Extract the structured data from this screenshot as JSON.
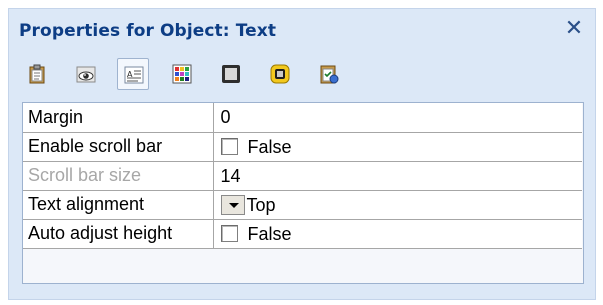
{
  "panel": {
    "title": "Properties for Object: Text",
    "close_glyph": "✕",
    "accent": "#0d3d85",
    "background": "#dce8f7"
  },
  "toolbar": {
    "tabs": [
      {
        "icon": "clipboard-icon",
        "active": false
      },
      {
        "icon": "eye-icon",
        "active": false
      },
      {
        "icon": "text-properties-icon",
        "active": true
      },
      {
        "icon": "color-grid-icon",
        "active": false
      },
      {
        "icon": "border-icon",
        "active": false
      },
      {
        "icon": "fill-icon",
        "active": false
      },
      {
        "icon": "checklist-icon",
        "active": false
      }
    ]
  },
  "properties": [
    {
      "name": "Margin",
      "value": "0",
      "control": "text",
      "disabled": false
    },
    {
      "name": "Enable scroll bar",
      "value": "False",
      "control": "checkbox",
      "checked": false,
      "disabled": false
    },
    {
      "name": "Scroll bar size",
      "value": "14",
      "control": "text",
      "disabled": true
    },
    {
      "name": "Text alignment",
      "value": "Top",
      "control": "dropdown",
      "disabled": false
    },
    {
      "name": "Auto adjust height",
      "value": "False",
      "control": "checkbox",
      "checked": false,
      "disabled": false
    }
  ]
}
